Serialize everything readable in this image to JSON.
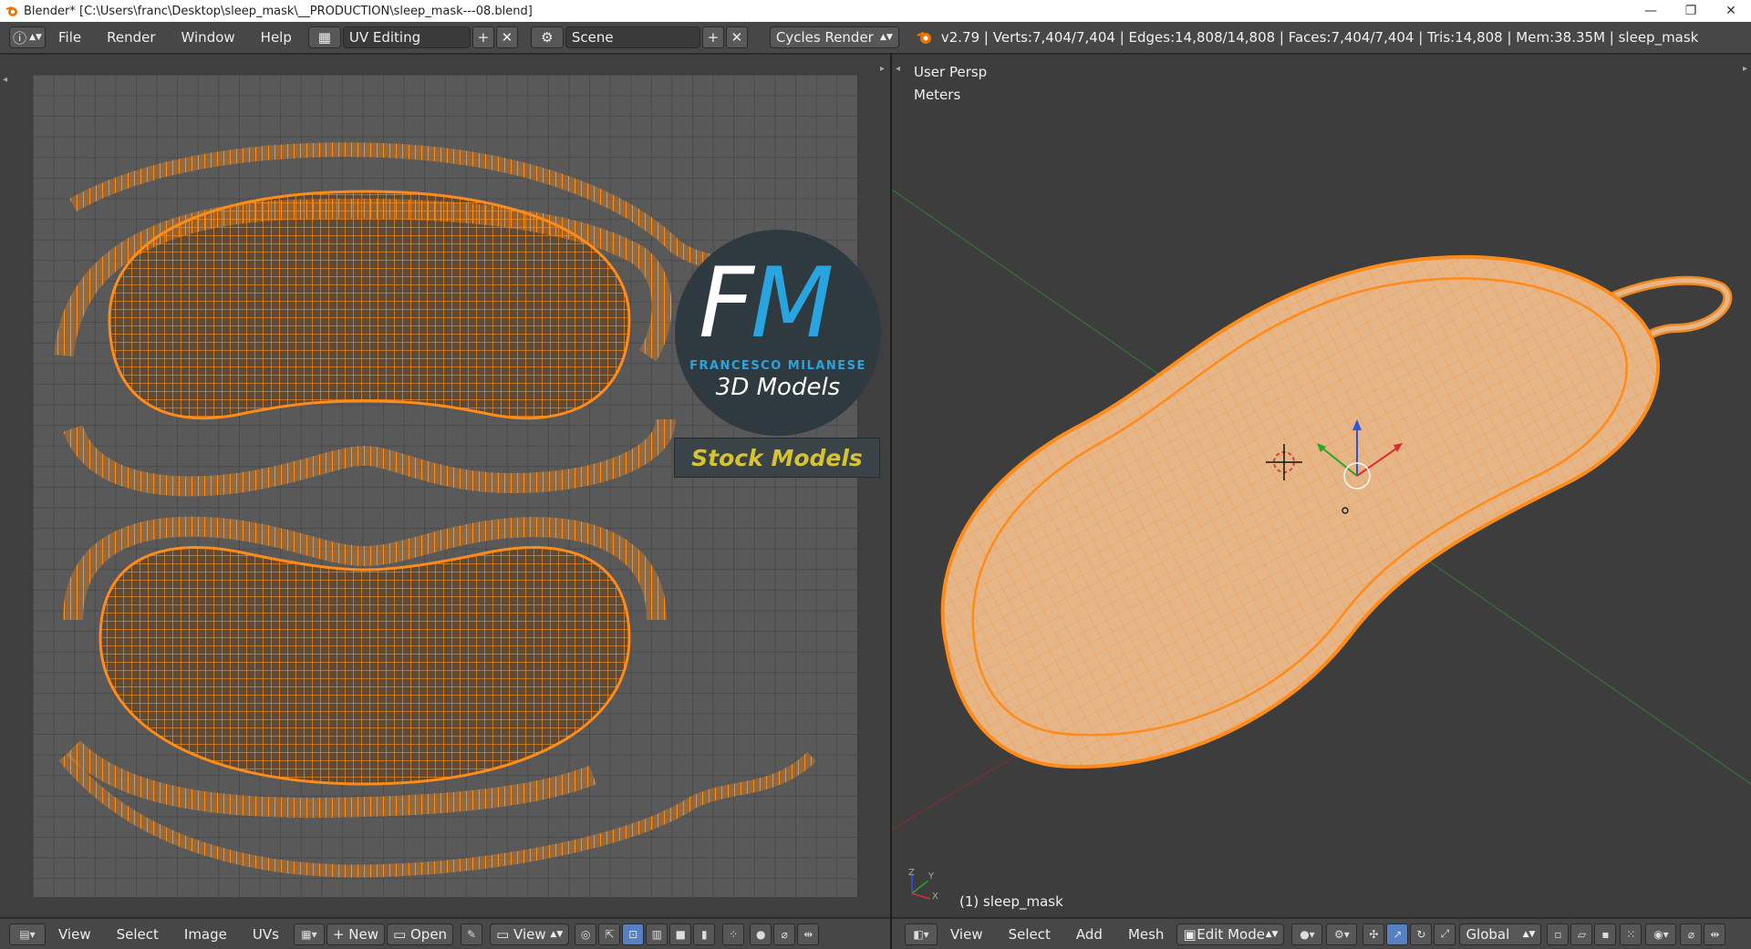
{
  "window": {
    "title": "Blender* [C:\\Users\\franc\\Desktop\\sleep_mask\\__PRODUCTION\\sleep_mask---08.blend]",
    "controls": [
      "—",
      "❐",
      "✕"
    ]
  },
  "topbar": {
    "menus": [
      "File",
      "Render",
      "Window",
      "Help"
    ],
    "layout": "UV Editing",
    "scene": "Scene",
    "engine": "Cycles Render",
    "stats": "v2.79 | Verts:7,404/7,404 | Edges:14,808/14,808 | Faces:7,404/7,404 | Tris:14,808 | Mem:38.35M | sleep_mask"
  },
  "viewport": {
    "view_name": "User Persp",
    "units": "Meters",
    "object_label": "(1) sleep_mask",
    "axis_labels": {
      "x": "X",
      "y": "Y",
      "z": "Z"
    }
  },
  "uv_editor_bar": {
    "menus": [
      "View",
      "Select",
      "Image",
      "UVs"
    ],
    "new_label": "New",
    "open_label": "Open",
    "view_label": "View"
  },
  "viewport_bar": {
    "menus": [
      "View",
      "Select",
      "Add",
      "Mesh"
    ],
    "mode": "Edit Mode",
    "orientation": "Global"
  },
  "watermark": {
    "letters_f": "F",
    "letters_m": "M",
    "name": "FRANCESCO MILANESE",
    "tagline": "3D Models",
    "badge": "Stock Models"
  },
  "colors": {
    "mesh_wire": "#ff8c1a",
    "mesh_fill": "#e8b07a",
    "accent_blue": "#29a4df",
    "badge_yellow": "#d7c232"
  }
}
